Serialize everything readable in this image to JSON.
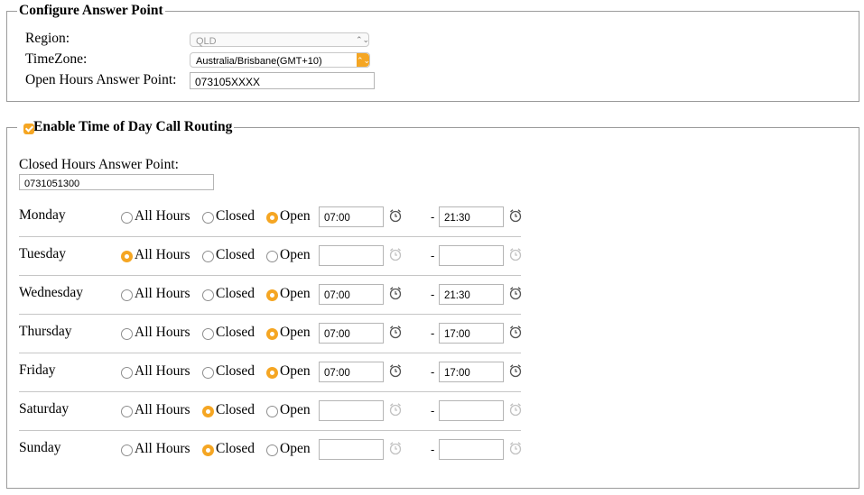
{
  "configure": {
    "legend": "Configure Answer Point",
    "region_label": "Region:",
    "region_value": "QLD",
    "timezone_label": "TimeZone:",
    "timezone_value": "Australia/Brisbane(GMT+10)",
    "open_hours_label": "Open Hours Answer Point:",
    "open_hours_value": "073105XXXX"
  },
  "routing": {
    "legend": "Enable Time of Day Call Routing",
    "enabled": true,
    "closed_hours_label": "Closed Hours Answer Point:",
    "closed_hours_value": "0731051300",
    "option_labels": {
      "all_hours": "All Hours",
      "closed": "Closed",
      "open": "Open"
    },
    "dash": "-",
    "days": [
      {
        "name": "Monday",
        "mode": "open",
        "start": "07:00",
        "end": "21:30"
      },
      {
        "name": "Tuesday",
        "mode": "all_hours",
        "start": "",
        "end": ""
      },
      {
        "name": "Wednesday",
        "mode": "open",
        "start": "07:00",
        "end": "21:30"
      },
      {
        "name": "Thursday",
        "mode": "open",
        "start": "07:00",
        "end": "17:00"
      },
      {
        "name": "Friday",
        "mode": "open",
        "start": "07:00",
        "end": "17:00"
      },
      {
        "name": "Saturday",
        "mode": "closed",
        "start": "",
        "end": ""
      },
      {
        "name": "Sunday",
        "mode": "closed",
        "start": "",
        "end": ""
      }
    ]
  },
  "colors": {
    "accent": "#f5a623",
    "border": "#9b9b9b"
  },
  "icons": {
    "clock": "alarm-clock-icon",
    "checkbox": "checkbox-checked-icon"
  }
}
